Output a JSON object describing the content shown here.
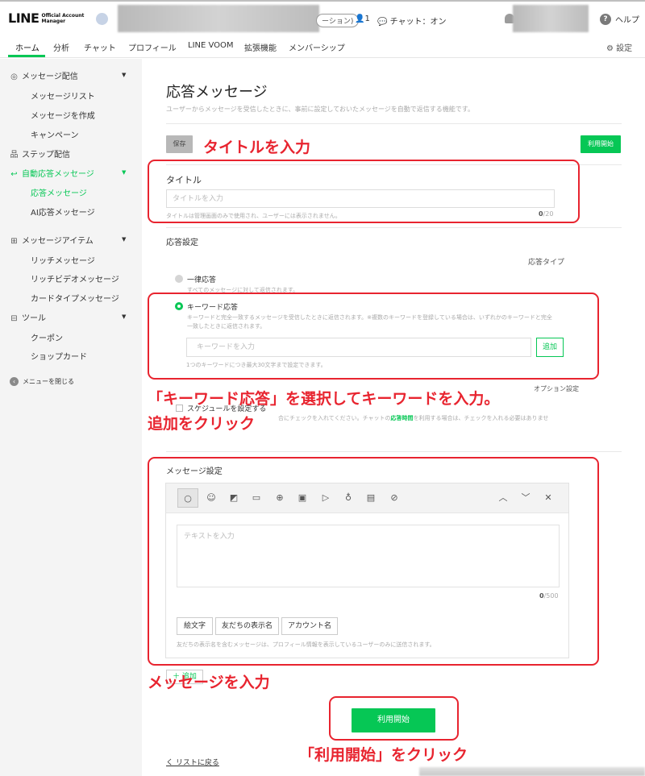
{
  "header": {
    "logo_main": "LINE",
    "logo_sub_1": "Official Account",
    "logo_sub_2": "Manager",
    "plan_chip": "ーション)",
    "friends_count": "👤1",
    "chat_status": "💬 チャット：オン",
    "help_icon_text": "?",
    "help_label": "ヘルプ"
  },
  "nav": {
    "tabs": [
      "ホーム",
      "分析",
      "チャット",
      "プロフィール",
      "LINE VOOM",
      "拡張機能",
      "メンバーシップ"
    ],
    "settings_label": "設定"
  },
  "sidebar": {
    "groups": [
      {
        "label": "メッセージ配信",
        "icon": "broadcast-icon",
        "items": [
          "メッセージリスト",
          "メッセージを作成",
          "キャンペーン"
        ]
      },
      {
        "label": "ステップ配信",
        "icon": "step-icon"
      },
      {
        "label": "自動応答メッセージ",
        "icon": "auto-reply-icon",
        "items": [
          "応答メッセージ",
          "AI応答メッセージ"
        ]
      },
      {
        "label": "メッセージアイテム",
        "icon": "message-item-icon",
        "items": [
          "リッチメッセージ",
          "リッチビデオメッセージ",
          "カードタイプメッセージ"
        ]
      },
      {
        "label": "ツール",
        "icon": "tool-icon",
        "items": [
          "クーポン",
          "ショップカード"
        ]
      }
    ],
    "close_menu": "メニューを閉じる"
  },
  "page": {
    "title": "応答メッセージ",
    "description": "ユーザーからメッセージを受信したときに、事前に設定しておいたメッセージを自動で返信する機能です。",
    "save_button": "保存",
    "start_button": "利用開始",
    "title_section": {
      "label": "タイトル",
      "placeholder": "タイトルを入力",
      "hint": "タイトルは管理画面のみで使用され、ユーザーには表示されません。",
      "count": "0",
      "max": "/20"
    },
    "response_settings": {
      "label": "応答設定",
      "type_label": "応答タイプ",
      "option_uniform": "一律応答",
      "option_uniform_desc": "すべてのメッセージに対して返信されます。",
      "option_keyword": "キーワード応答",
      "option_keyword_desc_1": "キーワードと完全一致するメッセージを受信したときに返信されます。※複数のキーワードを登録している場合は、いずれかのキーワードと完全",
      "option_keyword_desc_2": "一致したときに返信されます。",
      "keyword_placeholder": "キーワードを入力",
      "add_button": "追加",
      "keyword_hint": "1つのキーワードにつき最大30文字まで設定できます。",
      "option_settings_peek": "オプション設定",
      "schedule_label": "スケジュールを設定する",
      "schedule_desc_a": "合にチェックを入れてください。チャットの",
      "schedule_desc_link": "応答時間",
      "schedule_desc_b": "を利用する場合は、チェックを入れる必要はありませ"
    },
    "message_settings": {
      "label": "メッセージ設定",
      "text_placeholder": "テキストを入力",
      "count": "0",
      "max": "/500",
      "insert_buttons": [
        "絵文字",
        "友だちの表示名",
        "アカウント名"
      ],
      "hint": "友だちの表示名を含むメッセージは、プロフィール情報を表示しているユーザーのみに送信されます。",
      "toolbar_icons": [
        "speech-bubble-icon",
        "emoji-icon",
        "sticker-icon",
        "image-icon",
        "coupon-icon",
        "video-icon",
        "play-icon",
        "microphone-icon",
        "research-icon",
        "card-icon"
      ]
    },
    "add_message_button": "＋ 追加",
    "back_link": "く リストに戻る"
  },
  "annotations": {
    "title_instruction": "タイトルを入力",
    "keyword_instruction_1": "「キーワード応答」を選択してキーワードを入力。",
    "keyword_instruction_2": "追加をクリック",
    "message_instruction": "メッセージを入力",
    "start_instruction": "「利用開始」をクリック",
    "color": "#e8242f"
  },
  "colors": {
    "accent": "#06c755",
    "annotation": "#e8242f",
    "sidebar_bg": "#f4f4f4"
  }
}
